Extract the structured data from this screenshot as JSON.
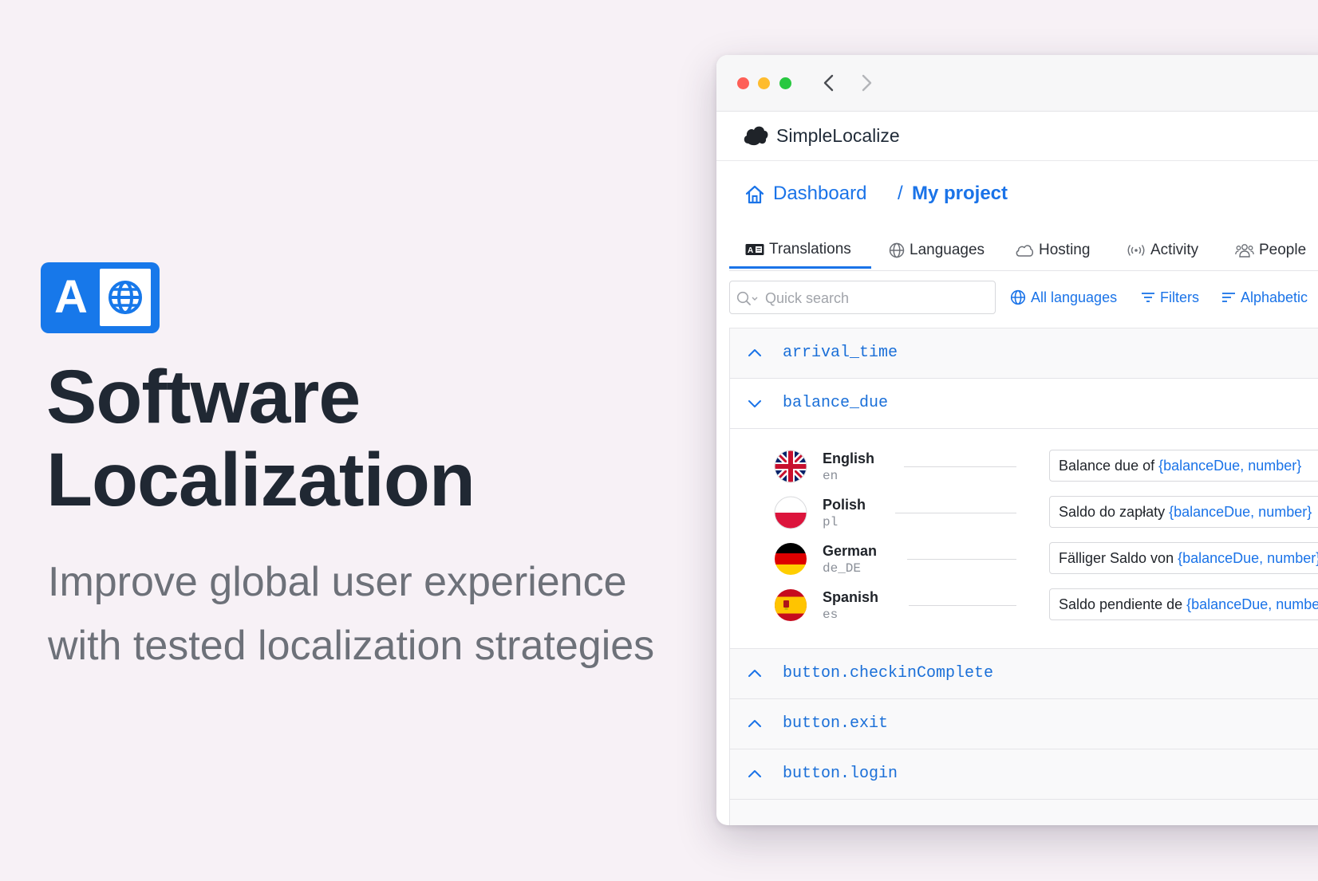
{
  "hero": {
    "logo_letter": "A",
    "title_line1": "Software",
    "title_line2": "Localization",
    "subtitle_line1": "Improve global user experience",
    "subtitle_line2": "with tested localization strategies"
  },
  "brand": {
    "name": "SimpleLocalize"
  },
  "breadcrumb": {
    "dashboard": "Dashboard",
    "separator": "/",
    "project": "My project"
  },
  "tabs": [
    {
      "label": "Translations",
      "icon": "translate-icon",
      "active": true
    },
    {
      "label": "Languages",
      "icon": "globe-icon"
    },
    {
      "label": "Hosting",
      "icon": "cloud-icon"
    },
    {
      "label": "Activity",
      "icon": "broadcast-icon"
    },
    {
      "label": "People",
      "icon": "people-icon"
    }
  ],
  "toolbar": {
    "search_placeholder": "Quick search",
    "languages_label": "All languages",
    "filters_label": "Filters",
    "sort_label": "Alphabetic"
  },
  "keys": [
    {
      "name": "arrival_time",
      "expanded": false
    },
    {
      "name": "balance_due",
      "expanded": true
    },
    {
      "name": "button.checkinComplete",
      "expanded": false
    },
    {
      "name": "button.exit",
      "expanded": false
    },
    {
      "name": "button.login",
      "expanded": false
    }
  ],
  "translations": [
    {
      "language": "English",
      "code": "en",
      "text": "Balance due of ",
      "placeholder": "{balanceDue, number}"
    },
    {
      "language": "Polish",
      "code": "pl",
      "text": "Saldo do zapłaty ",
      "placeholder": "{balanceDue, number}"
    },
    {
      "language": "German",
      "code": "de_DE",
      "text": "Fälliger Saldo von ",
      "placeholder": "{balanceDue, number}"
    },
    {
      "language": "Spanish",
      "code": "es",
      "text": "Saldo pendiente de ",
      "placeholder": "{balanceDue, number}"
    }
  ],
  "colors": {
    "accent": "#1a73e8",
    "background": "#f7f1f6",
    "title": "#202833",
    "subtitle": "#6d7179"
  }
}
